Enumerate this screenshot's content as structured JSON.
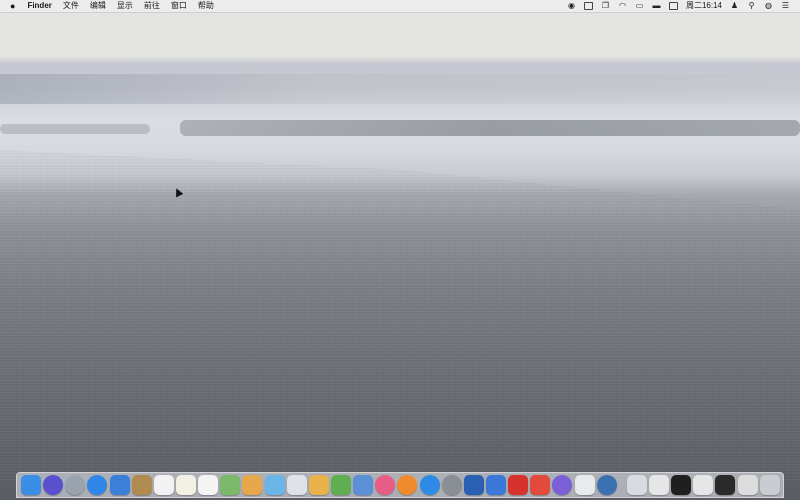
{
  "menubar": {
    "apple": "",
    "items": [
      {
        "label": "Finder",
        "bold": true
      },
      {
        "label": "文件"
      },
      {
        "label": "编辑"
      },
      {
        "label": "显示"
      },
      {
        "label": "前往"
      },
      {
        "label": "窗口"
      },
      {
        "label": "帮助"
      }
    ],
    "status_icons": [
      "record-icon",
      "display-icon",
      "copy-icon",
      "wifi-icon",
      "airplay-icon",
      "battery-icon",
      "keyboard-icon"
    ],
    "clock": "周二16:14",
    "extra_icons": [
      "user-icon",
      "spotlight-icon",
      "siri-icon",
      "notification-center-icon"
    ]
  },
  "dock": {
    "apps": [
      {
        "name": "finder-icon",
        "color": "#3a8ee6"
      },
      {
        "name": "siri-icon",
        "color": "#5a4fcf"
      },
      {
        "name": "launchpad-icon",
        "color": "#9aa3ad"
      },
      {
        "name": "safari-icon",
        "color": "#2f86e6"
      },
      {
        "name": "mail-icon",
        "color": "#3b7fd8"
      },
      {
        "name": "contacts-icon",
        "color": "#b08b4f"
      },
      {
        "name": "calendar-icon",
        "color": "#f2f2f2"
      },
      {
        "name": "notes-icon",
        "color": "#f3f1e4"
      },
      {
        "name": "reminders-icon",
        "color": "#f4f4f4"
      },
      {
        "name": "maps-icon",
        "color": "#7ab86a"
      },
      {
        "name": "photos-icon",
        "color": "#e6a84a"
      },
      {
        "name": "messages-icon",
        "color": "#6bb4e8"
      },
      {
        "name": "facetime-icon",
        "color": "#dfe3e8"
      },
      {
        "name": "pages-icon",
        "color": "#e9b24a"
      },
      {
        "name": "numbers-icon",
        "color": "#5fae52"
      },
      {
        "name": "keynote-icon",
        "color": "#5b8fd6"
      },
      {
        "name": "itunes-icon",
        "color": "#e85d86"
      },
      {
        "name": "ibooks-icon",
        "color": "#f08a2e"
      },
      {
        "name": "app-store-icon",
        "color": "#2d8be6"
      },
      {
        "name": "system-preferences-icon",
        "color": "#8a8f96"
      },
      {
        "name": "word-icon",
        "color": "#2b5fb3"
      },
      {
        "name": "wps-icon",
        "color": "#3b78d8"
      },
      {
        "name": "netease-icon",
        "color": "#d7322e"
      },
      {
        "name": "gift-icon",
        "color": "#e24b3b"
      },
      {
        "name": "screenflow-icon",
        "color": "#7a5fd6"
      },
      {
        "name": "mail-app-icon",
        "color": "#e9eaec"
      },
      {
        "name": "qq-browser-icon",
        "color": "#3a6fb0"
      }
    ],
    "stacks": [
      {
        "name": "downloads-stack-icon",
        "color": "#d8dbe0"
      },
      {
        "name": "document-stack-icon",
        "color": "#e6e6e6"
      },
      {
        "name": "screenshot-stack-icon",
        "color": "#1f1f1f"
      },
      {
        "name": "screenshot-stack-icon",
        "color": "#e6e6e6"
      },
      {
        "name": "screenshot-stack-icon",
        "color": "#2a2a2a"
      },
      {
        "name": "screenshot-stack-icon",
        "color": "#dcdcdc"
      },
      {
        "name": "trash-icon",
        "color": "#c9ccd1"
      }
    ]
  }
}
